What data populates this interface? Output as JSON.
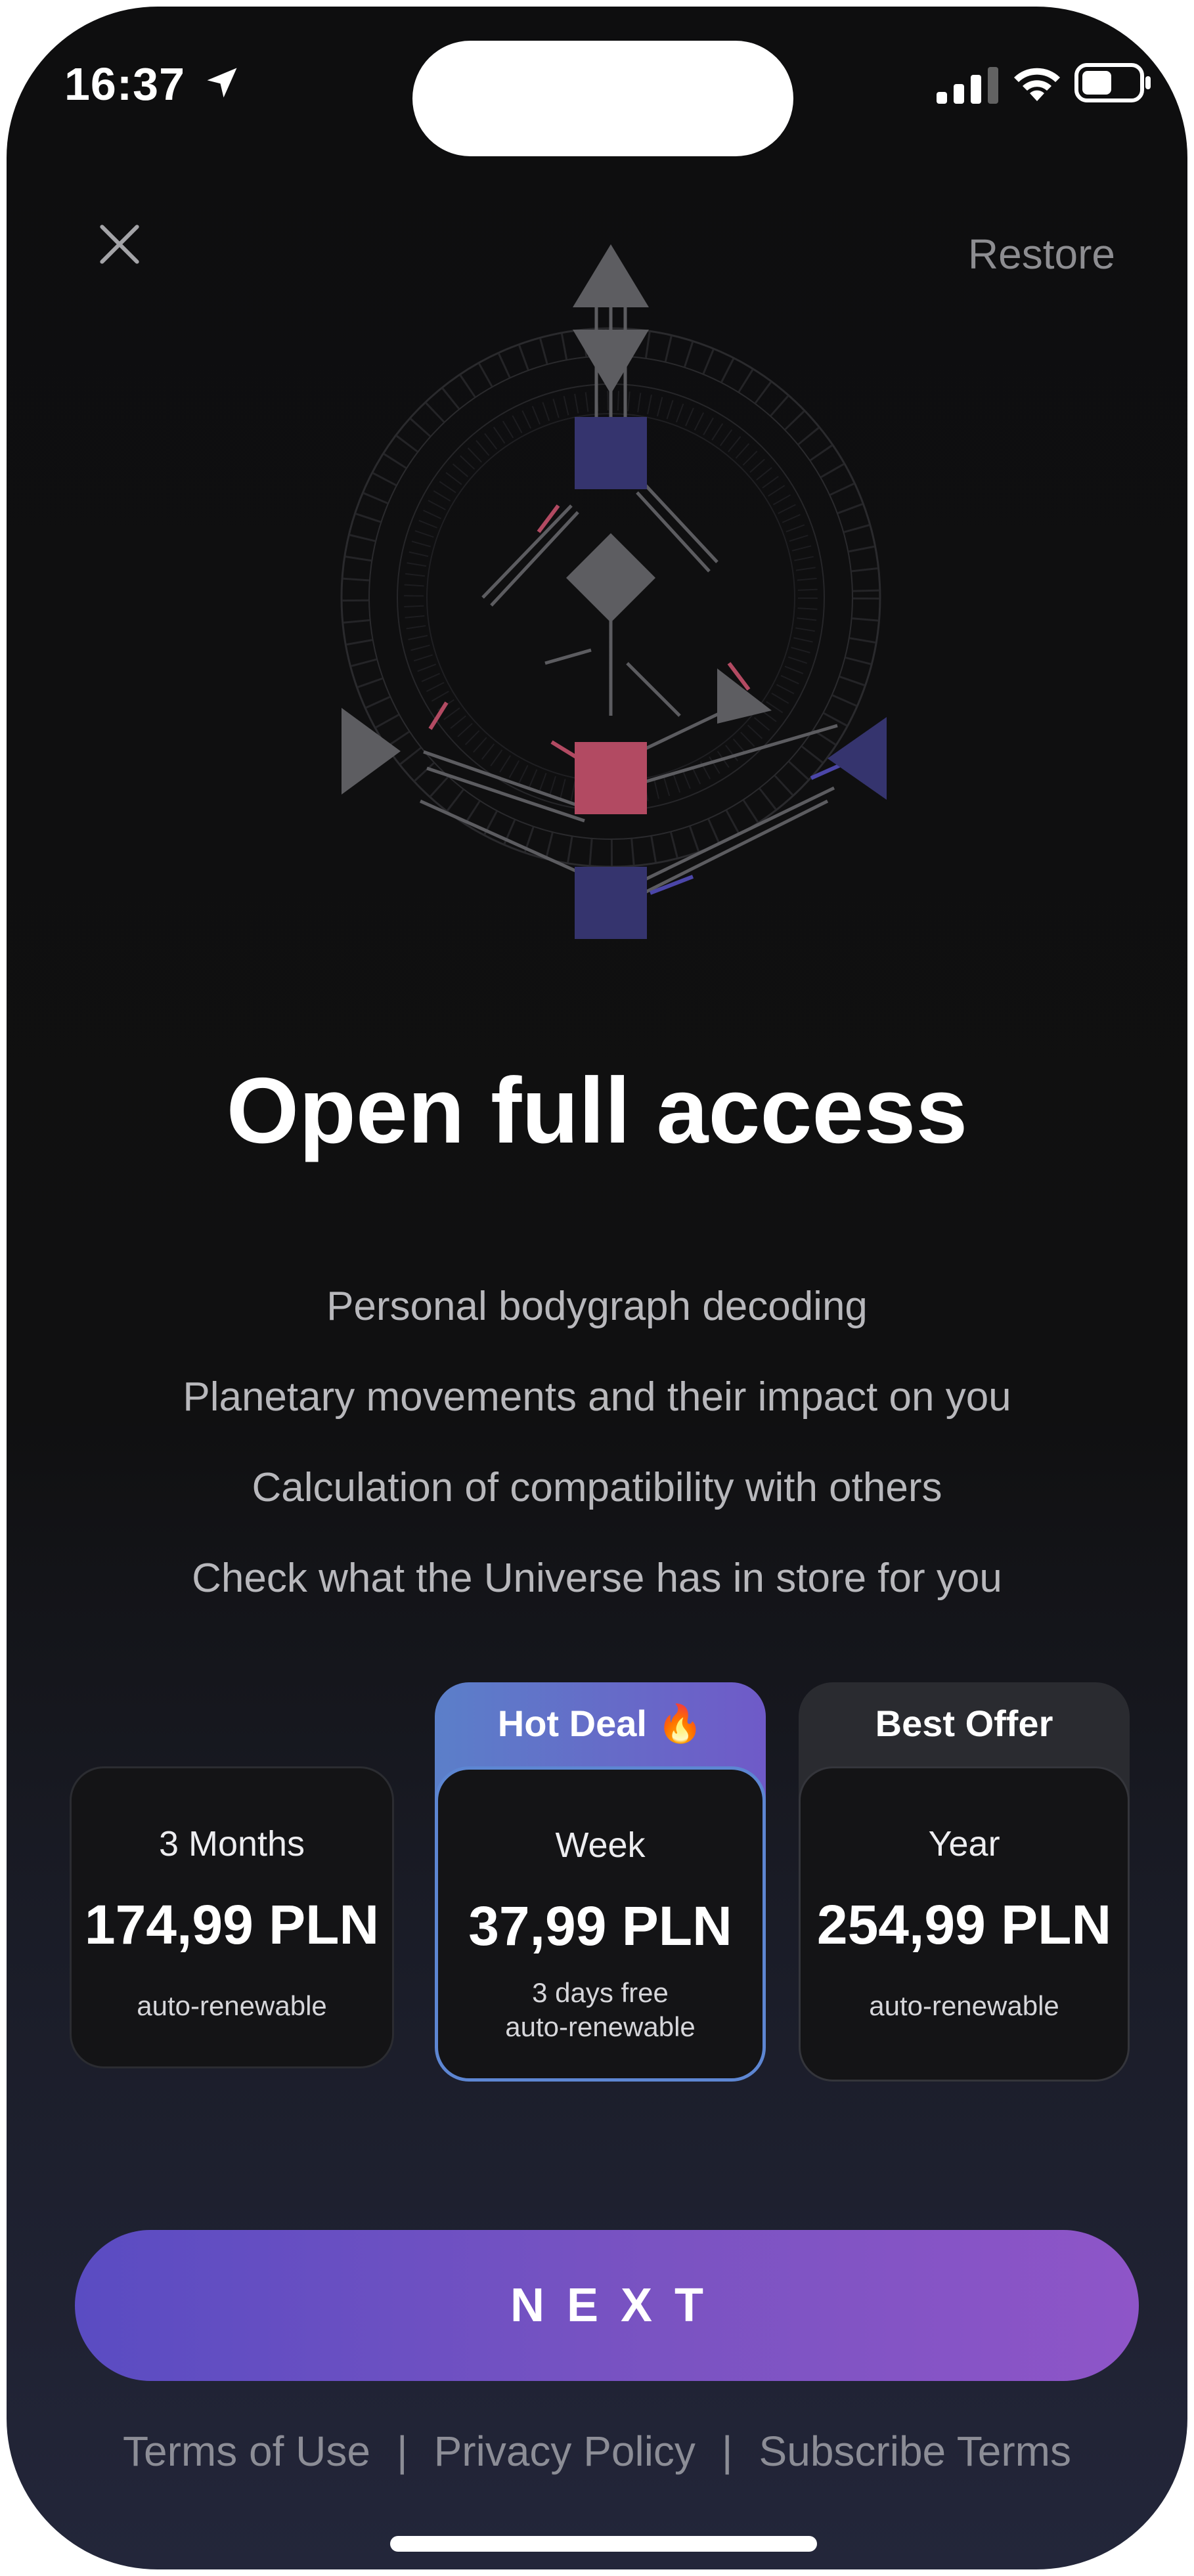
{
  "status_bar": {
    "time": "16:37"
  },
  "header": {
    "restore_label": "Restore"
  },
  "main": {
    "title": "Open full access",
    "features": [
      "Personal bodygraph decoding",
      "Planetary movements and their impact on you",
      "Calculation of compatibility with others",
      "Check what the Universe has in store for you"
    ]
  },
  "plans": [
    {
      "badge": "",
      "name": "3 Months",
      "price": "174,99 PLN",
      "trial": "",
      "renewal": "auto-renewable",
      "selected": false
    },
    {
      "badge": "Hot Deal 🔥",
      "name": "Week",
      "price": "37,99 PLN",
      "trial": "3 days free",
      "renewal": "auto-renewable",
      "selected": true
    },
    {
      "badge": "Best Offer",
      "name": "Year",
      "price": "254,99 PLN",
      "trial": "",
      "renewal": "auto-renewable",
      "selected": false
    }
  ],
  "cta": {
    "label": "NEXT"
  },
  "footer": {
    "terms": "Terms of Use",
    "privacy": "Privacy Policy",
    "subscribe": "Subscribe Terms",
    "separator": "|"
  },
  "colors": {
    "accent_start": "#5a4cc2",
    "accent_end": "#8e55c8",
    "selected_border": "#5d86d2",
    "gate_blue": "#35346e",
    "gate_red": "#b24a62"
  },
  "icons": [
    "location-arrow-icon",
    "signal-icon",
    "wifi-icon",
    "battery-icon",
    "close-icon",
    "bodygraph-illustration"
  ]
}
